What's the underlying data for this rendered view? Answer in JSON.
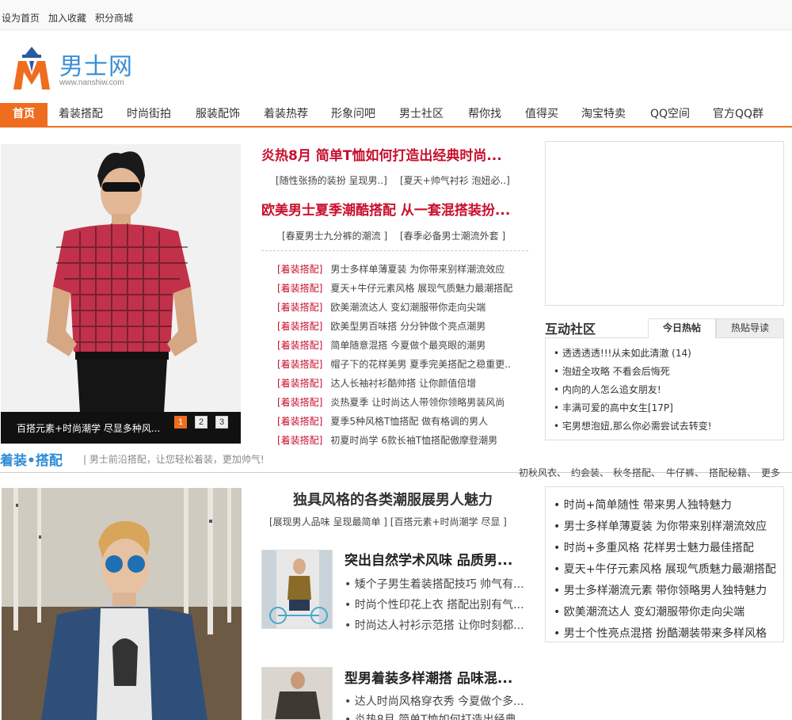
{
  "topbar": {
    "set_home": "设为首页",
    "add_fav": "加入收藏",
    "points_mall": "积分商城"
  },
  "logo": {
    "name": "男士网",
    "url": "www.nanshiw.com"
  },
  "nav": {
    "items": [
      "首页",
      "着装搭配",
      "时尚街拍",
      "服装配饰",
      "着装热荐",
      "形象问吧",
      "男士社区",
      "帮你找",
      "值得买",
      "淘宝特卖",
      "QQ空间",
      "官方QQ群"
    ]
  },
  "hero": {
    "caption": "百搭元素+时尚潮学 尽显多种风...",
    "pages": [
      "1",
      "2",
      "3"
    ]
  },
  "headlines": [
    {
      "title": "炎热8月 简单T恤如何打造出经典时尚...",
      "sub1": "[随性张扬的装扮 呈现男..]",
      "sub2": "[夏天+帅气衬衫 泡妞必..]"
    },
    {
      "title": "欧美男士夏季潮酷搭配 从一套混搭装扮...",
      "sub1": "[春夏男士九分裤的潮流 ]",
      "sub2": "[春季必备男士潮流外套 ]"
    }
  ],
  "news_list": [
    {
      "tag": "[着装搭配]",
      "text": "男士多样单薄夏装 为你带来别样潮流效应"
    },
    {
      "tag": "[着装搭配]",
      "text": "夏天+牛仔元素风格 展现气质魅力最潮搭配"
    },
    {
      "tag": "[着装搭配]",
      "text": "欧美潮流达人 变幻潮服带你走向尖端"
    },
    {
      "tag": "[着装搭配]",
      "text": "欧美型男百味搭 分分钟做个亮点潮男"
    },
    {
      "tag": "[着装搭配]",
      "text": "简单随意混搭 今夏做个最亮眼的潮男"
    },
    {
      "tag": "[着装搭配]",
      "text": "帽子下的花样美男 夏季完美搭配之稳重更.."
    },
    {
      "tag": "[着装搭配]",
      "text": "达人长袖衬衫酷帅搭 让你颜值倍增"
    },
    {
      "tag": "[着装搭配]",
      "text": "炎热夏季 让时尚达人带领你领略男装风尚"
    },
    {
      "tag": "[着装搭配]",
      "text": "夏季5种风格T恤搭配 做有格调的男人"
    },
    {
      "tag": "[着装搭配]",
      "text": "初夏时尚学 6款长袖T恤搭配傲摩登潮男"
    }
  ],
  "community": {
    "title": "互动社区",
    "tabs": [
      "今日热帖",
      "热贴导读"
    ],
    "items": [
      "透透透透!!!从未如此清澈 (14)",
      "泡妞全攻略 不看会后悔死",
      "内向的人怎么追女朋友!",
      "丰满可爱的高中女生[17P]",
      "宅男想泡妞,那么你必需尝试去转变!"
    ]
  },
  "section2": {
    "title": "着装•搭配",
    "desc": "| 男士前沿搭配，让您轻松着装，更加帅气!",
    "links": [
      "初秋风衣、",
      "约会装、",
      "秋冬搭配、",
      "牛仔裤、",
      "搭配秘籍、",
      "更多"
    ]
  },
  "mid": {
    "title": "独具风格的各类潮服展男人魅力",
    "sub": "[展现男人品味 呈现最简单 ] [百搭元素+时尚潮学 尽显 ]",
    "cards": [
      {
        "title": "突出自然学术风味 品质男...",
        "items": [
          "矮个子男生着装搭配技巧 帅气有...",
          "时尚个性印花上衣 搭配出别有气...",
          "时尚达人衬衫示范搭 让你时刻都..."
        ]
      },
      {
        "title": "型男着装多样潮搭 品味混...",
        "items": [
          "达人时尚风格穿衣秀 今夏做个多...",
          "炎热8月 简单T恤如何打造出经典..."
        ]
      }
    ]
  },
  "right_list": [
    "时尚+简单随性 带来男人独特魅力",
    "男士多样单薄夏装 为你带来别样潮流效应",
    "时尚+多重风格 花样男士魅力最佳搭配",
    "夏天+牛仔元素风格 展现气质魅力最潮搭配",
    "男士多样潮流元素 带你领略男人独特魅力",
    "欧美潮流达人 变幻潮服带你走向尖端",
    "男士个性亮点混搭 扮酷潮装带来多样风格"
  ],
  "colors": {
    "accent": "#ef6d1f",
    "headline_red": "#c8102e",
    "section_blue": "#2f8cd6",
    "logo_blue": "#3a8fd6"
  }
}
